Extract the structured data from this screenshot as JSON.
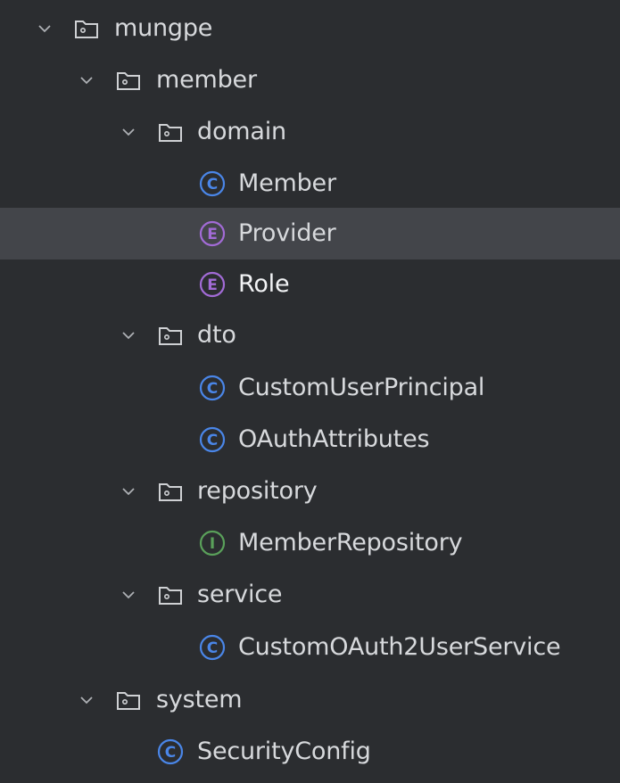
{
  "colors": {
    "background": "#2b2d30",
    "selected_row": "#43454a",
    "text": "#d7d9dc",
    "class_icon": "#4a86e8",
    "enum_icon": "#a26bd6",
    "interface_icon": "#5aa05a",
    "folder_icon": "#cfd1d4"
  },
  "tree": {
    "nodes": [
      {
        "label": "mungpe",
        "kind": "package",
        "icon": "folder-icon",
        "expanded": true
      },
      {
        "label": "member",
        "kind": "package",
        "icon": "folder-icon",
        "expanded": true
      },
      {
        "label": "domain",
        "kind": "package",
        "icon": "folder-icon",
        "expanded": true
      },
      {
        "label": "Member",
        "kind": "class",
        "icon": "class-icon",
        "glyph": "C"
      },
      {
        "label": "Provider",
        "kind": "enum",
        "icon": "enum-icon",
        "glyph": "E",
        "selected": true
      },
      {
        "label": "Role",
        "kind": "enum",
        "icon": "enum-icon",
        "glyph": "E"
      },
      {
        "label": "dto",
        "kind": "package",
        "icon": "folder-icon",
        "expanded": true
      },
      {
        "label": "CustomUserPrincipal",
        "kind": "class",
        "icon": "class-icon",
        "glyph": "C"
      },
      {
        "label": "OAuthAttributes",
        "kind": "class",
        "icon": "class-icon",
        "glyph": "C"
      },
      {
        "label": "repository",
        "kind": "package",
        "icon": "folder-icon",
        "expanded": true
      },
      {
        "label": "MemberRepository",
        "kind": "interface",
        "icon": "interface-icon",
        "glyph": "I"
      },
      {
        "label": "service",
        "kind": "package",
        "icon": "folder-icon",
        "expanded": true
      },
      {
        "label": "CustomOAuth2UserService",
        "kind": "class",
        "icon": "class-icon",
        "glyph": "C"
      },
      {
        "label": "system",
        "kind": "package",
        "icon": "folder-icon",
        "expanded": true
      },
      {
        "label": "SecurityConfig",
        "kind": "class",
        "icon": "class-icon",
        "glyph": "C"
      }
    ]
  }
}
